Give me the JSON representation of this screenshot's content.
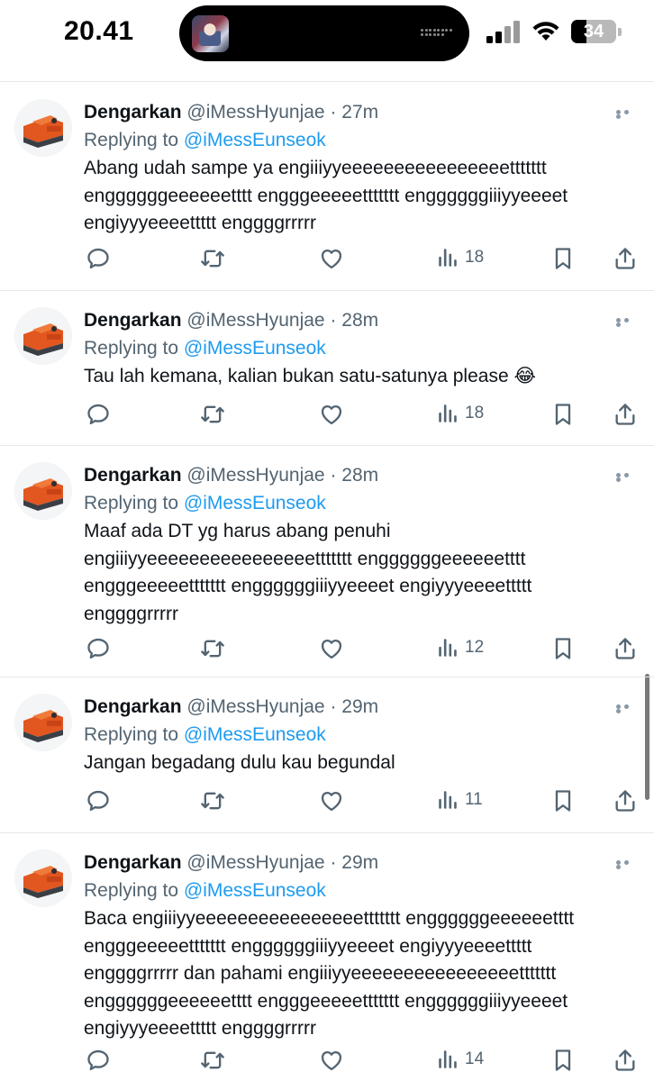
{
  "status_bar": {
    "time": "20.41",
    "battery": "34",
    "battery_level_percent": 34
  },
  "tweets": [
    {
      "name": "Dengarkan",
      "handle": "@iMessHyunjae",
      "time": "27m",
      "replying_prefix": "Replying to",
      "replying_to": "@iMessEunseok",
      "text": "Abang udah sampe ya engiiiyyeeeeeeeeeeeeeeeettttttt enggggggeeeeeetttt engggeeeeettttttt enggggggiiiyyeeeet engiyyyeeeettttt enggggrrrrr",
      "views": "18"
    },
    {
      "name": "Dengarkan",
      "handle": "@iMessHyunjae",
      "time": "28m",
      "replying_prefix": "Replying to",
      "replying_to": "@iMessEunseok",
      "text": "Tau lah kemana, kalian bukan satu-satunya please 😂",
      "views": "18"
    },
    {
      "name": "Dengarkan",
      "handle": "@iMessHyunjae",
      "time": "28m",
      "replying_prefix": "Replying to",
      "replying_to": "@iMessEunseok",
      "text": "Maaf ada DT yg harus abang penuhi engiiiyyeeeeeeeeeeeeeeeettttttt enggggggeeeeeetttt engggeeeeettttttt enggggggiiiyyeeeet engiyyyeeeettttt enggggrrrrr",
      "views": "12"
    },
    {
      "name": "Dengarkan",
      "handle": "@iMessHyunjae",
      "time": "29m",
      "replying_prefix": "Replying to",
      "replying_to": "@iMessEunseok",
      "text": "Jangan begadang dulu kau begundal",
      "views": "11"
    },
    {
      "name": "Dengarkan",
      "handle": "@iMessHyunjae",
      "time": "29m",
      "replying_prefix": "Replying to",
      "replying_to": "@iMessEunseok",
      "text": "Baca engiiiyyeeeeeeeeeeeeeeeettttttt enggggggeeeeeetttt engggeeeeettttttt enggggggiiiyyeeeet engiyyyeeeettttt enggggrrrrr dan pahami engiiiyyeeeeeeeeeeeeeeeettttttt enggggggeeeeeetttt engggeeeeettttttt enggggggiiiyyeeeet engiyyyeeeettttt enggggrrrrr",
      "views": "14"
    }
  ],
  "icons": {
    "reply": "reply-icon",
    "retweet": "retweet-icon",
    "like": "heart-icon",
    "views": "views-icon",
    "bookmark": "bookmark-icon",
    "share": "share-icon",
    "more": "more-icon"
  },
  "colors": {
    "link": "#1d9bf0",
    "secondary_text": "#536471",
    "primary_text": "#0f1419",
    "icon": "#536471"
  }
}
